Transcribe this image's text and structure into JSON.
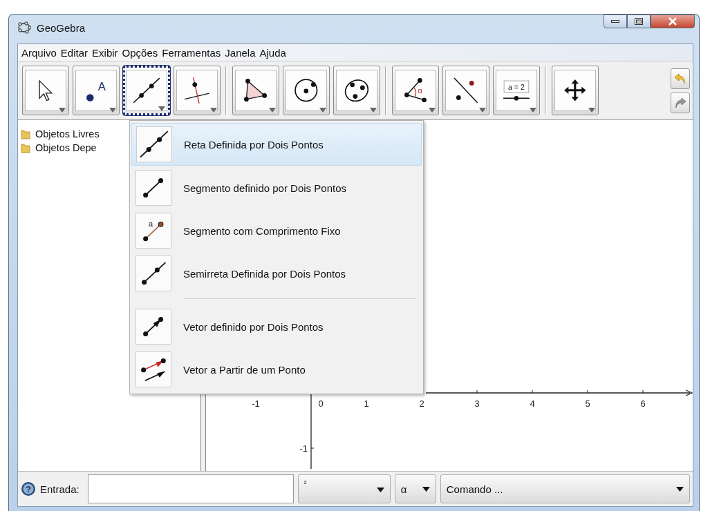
{
  "window": {
    "title": "GeoGebra"
  },
  "menu": [
    "Arquivo",
    "Editar",
    "Exibir",
    "Opções",
    "Ferramentas",
    "Janela",
    "Ajuda"
  ],
  "toolbar": {
    "tools": [
      {
        "kind": "move",
        "selected": false
      },
      {
        "kind": "point",
        "icon_text": "A",
        "selected": false
      },
      {
        "kind": "line",
        "selected": true
      },
      {
        "kind": "perpendicular",
        "selected": false
      },
      {
        "kind": "polygon",
        "selected": false
      },
      {
        "kind": "circle",
        "selected": false
      },
      {
        "kind": "conic",
        "selected": false
      },
      {
        "kind": "angle",
        "icon_text": "α",
        "selected": false
      },
      {
        "kind": "reflect",
        "selected": false
      },
      {
        "kind": "slider",
        "icon_text": "a = 2",
        "selected": false
      },
      {
        "kind": "move-view",
        "selected": false
      }
    ]
  },
  "algebra": {
    "items": [
      {
        "label": "Objetos Livres"
      },
      {
        "label": "Objetos Depe"
      }
    ]
  },
  "tool_menu": {
    "items": [
      {
        "kind": "line",
        "label": "Reta Definida por Dois Pontos",
        "selected": true,
        "separator_before": false
      },
      {
        "kind": "segment",
        "label": "Segmento definido por Dois Pontos",
        "selected": false,
        "separator_before": false
      },
      {
        "kind": "fixed-segment",
        "icon_text": "a",
        "label": "Segmento com Comprimento Fixo",
        "selected": false,
        "separator_before": false
      },
      {
        "kind": "ray",
        "label": "Semirreta Definida por Dois Pontos",
        "selected": false,
        "separator_before": false
      },
      {
        "kind": "vector",
        "label": "Vetor definido por Dois Pontos",
        "selected": false,
        "separator_before": true
      },
      {
        "kind": "vector-from-point",
        "label": "Vetor a Partir de um Ponto",
        "selected": false,
        "separator_before": false
      }
    ]
  },
  "graphics": {
    "x_tick_labels": [
      "-1",
      "0",
      "1",
      "2",
      "3",
      "4",
      "5",
      "6"
    ],
    "y_tick_labels": [
      "-1"
    ]
  },
  "input_bar": {
    "help_symbol": "?",
    "label": "Entrada:",
    "symbols": "²",
    "greek": "α",
    "command": "Comando ..."
  }
}
